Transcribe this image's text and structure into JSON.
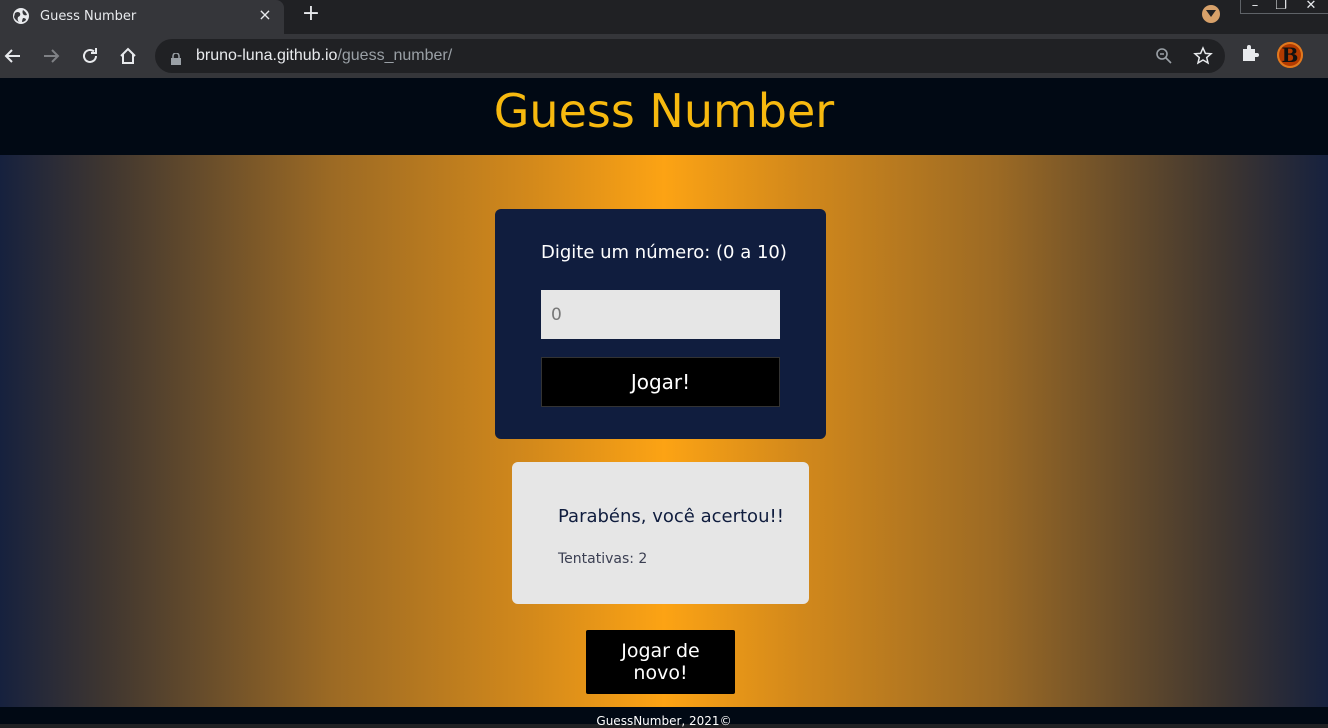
{
  "browser": {
    "tab": {
      "title": "Guess Number",
      "favicon": "globe-icon",
      "close": "×"
    },
    "new_tab": "+",
    "url": {
      "host": "bruno-luna.github.io",
      "path": "/guess_number/"
    },
    "profile_initial": "B",
    "window_controls": {
      "minimize": "–",
      "restore": "❐",
      "close": "✕"
    }
  },
  "page": {
    "title": "Guess Number",
    "form": {
      "label": "Digite um número: (0 a 10)",
      "input_placeholder": "0",
      "submit": "Jogar!"
    },
    "result": {
      "message": "Parabéns, você acertou!!",
      "attempts": "Tentativas: 2"
    },
    "play_again": "Jogar de novo!",
    "footer": "GuessNumber,  2021©"
  },
  "colors": {
    "accent": "#f7b90f",
    "card_bg": "#101d3e",
    "header_bg": "#010914",
    "gradient_center": "#fca314"
  }
}
